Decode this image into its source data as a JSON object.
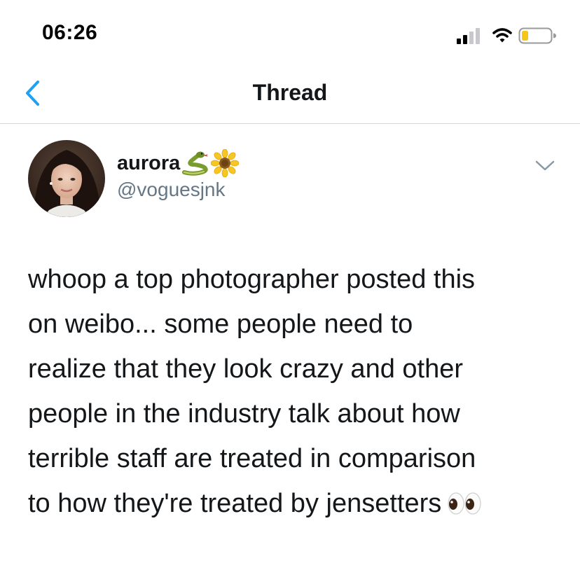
{
  "status_bar": {
    "time": "06:26",
    "icons": [
      "signal-icon",
      "wifi-icon",
      "battery-icon"
    ],
    "battery_level": 0.2
  },
  "nav": {
    "back_icon": "chevron-left-icon",
    "title": "Thread"
  },
  "tweet": {
    "author": {
      "display_name": "aurora",
      "name_emojis": [
        "snake-emoji",
        "sunflower-emoji"
      ],
      "handle": "@voguesjnk"
    },
    "more_icon": "chevron-down-icon",
    "text_lines": [
      "whoop a top photographer posted this",
      "on weibo... some people need to",
      "realize that they look crazy and other",
      "people in the industry talk about how",
      "terrible staff are treated in comparison",
      "to how they're treated by jensetters"
    ],
    "trailing_emoji": "eyes-emoji"
  },
  "colors": {
    "accent": "#1da1f2",
    "text_primary": "#14171a",
    "text_secondary": "#657786",
    "divider": "#d6d6d6",
    "battery_low": "#f5c518"
  }
}
